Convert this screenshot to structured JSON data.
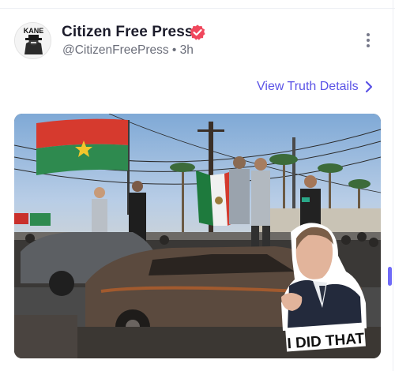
{
  "post": {
    "author": {
      "name": "Citizen Free Press",
      "handle": "@CitizenFreePress",
      "separator": "•",
      "time": "3h",
      "avatar_text": "KANE",
      "verified_color": "#f0475c"
    },
    "view_truth_details_label": "View Truth Details",
    "image": {
      "sticker_caption": "I DID THAT"
    }
  },
  "colors": {
    "accent": "#5b53e6",
    "scrollbar": "#6f6af8"
  },
  "icons": [
    "avatar-image",
    "verified-badge-icon",
    "more-options-icon",
    "chevron-right-icon"
  ]
}
